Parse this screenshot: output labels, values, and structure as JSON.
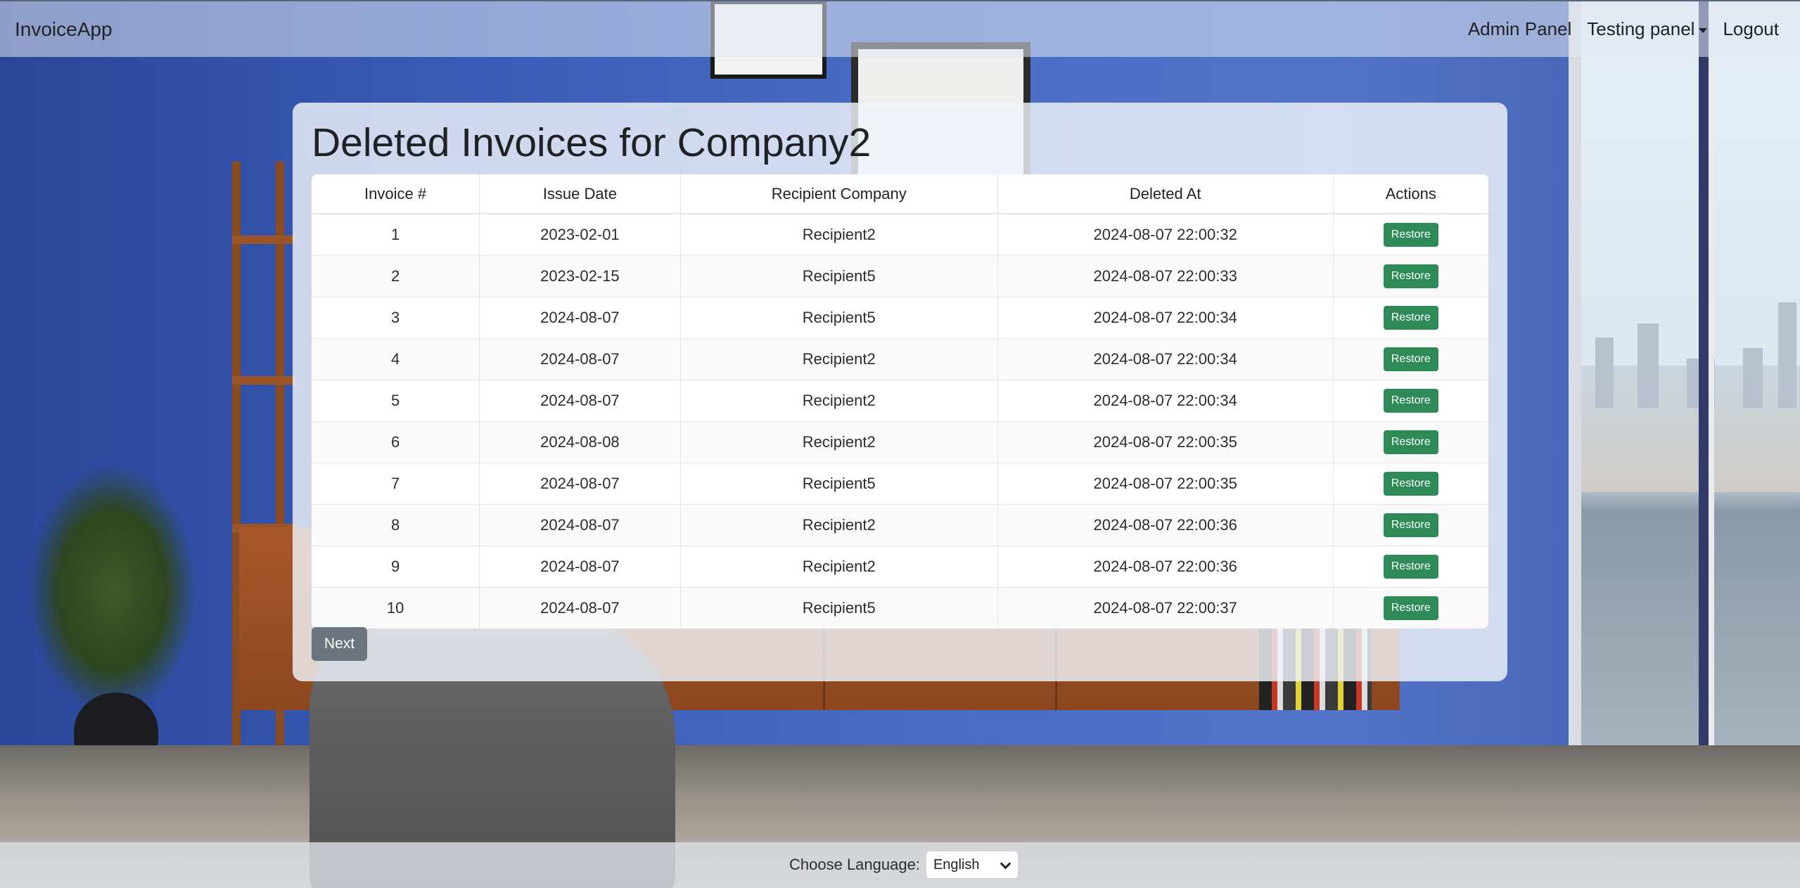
{
  "navbar": {
    "brand": "InvoiceApp",
    "links": {
      "admin": "Admin Panel",
      "testing": "Testing panel",
      "logout": "Logout"
    }
  },
  "page": {
    "title": "Deleted Invoices for Company2"
  },
  "table": {
    "headers": [
      "Invoice #",
      "Issue Date",
      "Recipient Company",
      "Deleted At",
      "Actions"
    ],
    "rows": [
      {
        "invoice": "1",
        "issue_date": "2023-02-01",
        "recipient": "Recipient2",
        "deleted_at": "2024-08-07 22:00:32",
        "action": "Restore"
      },
      {
        "invoice": "2",
        "issue_date": "2023-02-15",
        "recipient": "Recipient5",
        "deleted_at": "2024-08-07 22:00:33",
        "action": "Restore"
      },
      {
        "invoice": "3",
        "issue_date": "2024-08-07",
        "recipient": "Recipient5",
        "deleted_at": "2024-08-07 22:00:34",
        "action": "Restore"
      },
      {
        "invoice": "4",
        "issue_date": "2024-08-07",
        "recipient": "Recipient2",
        "deleted_at": "2024-08-07 22:00:34",
        "action": "Restore"
      },
      {
        "invoice": "5",
        "issue_date": "2024-08-07",
        "recipient": "Recipient2",
        "deleted_at": "2024-08-07 22:00:34",
        "action": "Restore"
      },
      {
        "invoice": "6",
        "issue_date": "2024-08-08",
        "recipient": "Recipient2",
        "deleted_at": "2024-08-07 22:00:35",
        "action": "Restore"
      },
      {
        "invoice": "7",
        "issue_date": "2024-08-07",
        "recipient": "Recipient5",
        "deleted_at": "2024-08-07 22:00:35",
        "action": "Restore"
      },
      {
        "invoice": "8",
        "issue_date": "2024-08-07",
        "recipient": "Recipient2",
        "deleted_at": "2024-08-07 22:00:36",
        "action": "Restore"
      },
      {
        "invoice": "9",
        "issue_date": "2024-08-07",
        "recipient": "Recipient2",
        "deleted_at": "2024-08-07 22:00:36",
        "action": "Restore"
      },
      {
        "invoice": "10",
        "issue_date": "2024-08-07",
        "recipient": "Recipient5",
        "deleted_at": "2024-08-07 22:00:37",
        "action": "Restore"
      }
    ]
  },
  "pagination": {
    "next_label": "Next"
  },
  "footer": {
    "language_label": "Choose Language:",
    "language_value": "English"
  },
  "colors": {
    "restore_button": "#2e8a57",
    "next_button": "#6c747d"
  }
}
